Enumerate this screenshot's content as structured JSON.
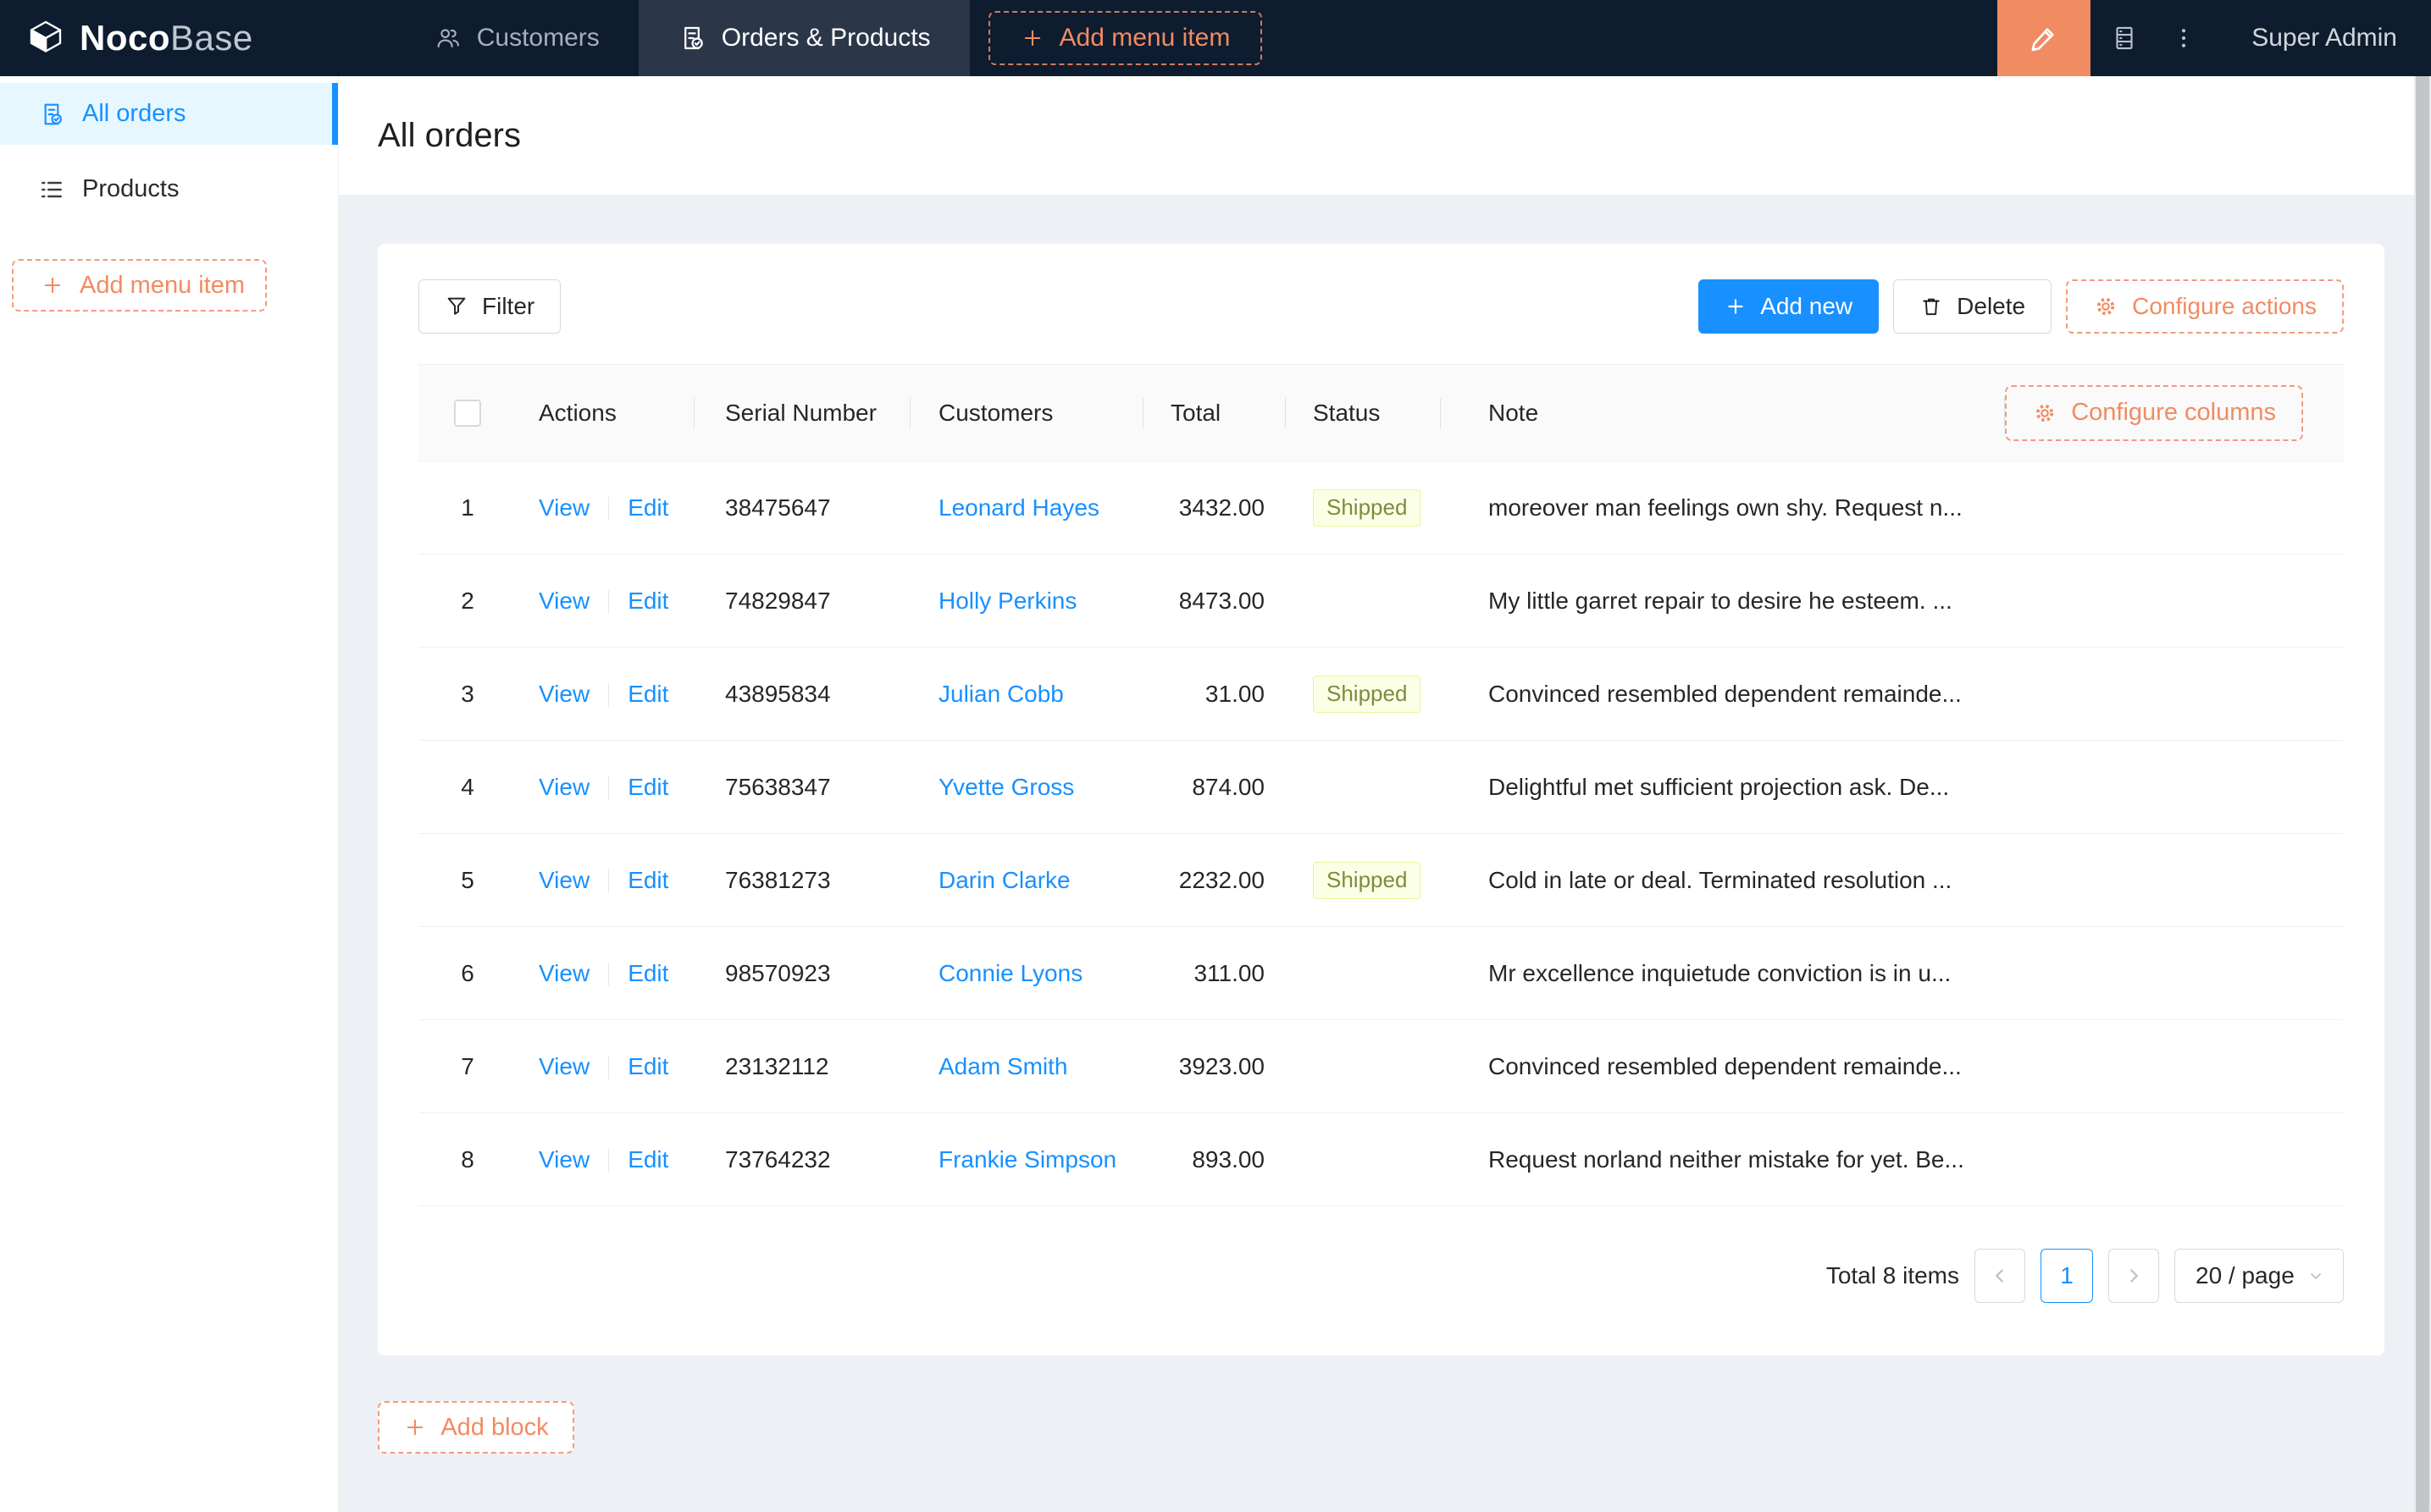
{
  "header": {
    "logo": {
      "bold": "Noco",
      "light": "Base"
    },
    "menu": [
      {
        "label": "Customers"
      },
      {
        "label": "Orders & Products"
      }
    ],
    "add_menu_item_label": "Add menu item",
    "user": "Super Admin"
  },
  "sidebar": {
    "items": [
      {
        "label": "All orders"
      },
      {
        "label": "Products"
      }
    ],
    "add_menu_item_label": "Add menu item"
  },
  "page": {
    "title": "All orders"
  },
  "toolbar": {
    "filter_label": "Filter",
    "add_new_label": "Add new",
    "delete_label": "Delete",
    "configure_actions_label": "Configure actions"
  },
  "table": {
    "configure_columns_label": "Configure columns",
    "columns": {
      "actions": "Actions",
      "serial": "Serial Number",
      "customers": "Customers",
      "total": "Total",
      "status": "Status",
      "note": "Note"
    },
    "actions": {
      "view": "View",
      "edit": "Edit"
    },
    "rows": [
      {
        "index": "1",
        "serial": "38475647",
        "customer": "Leonard Hayes",
        "total": "3432.00",
        "status": "Shipped",
        "note": "moreover man feelings own shy. Request n..."
      },
      {
        "index": "2",
        "serial": "74829847",
        "customer": "Holly Perkins",
        "total": "8473.00",
        "status": "",
        "note": "My little garret repair to desire he esteem. ..."
      },
      {
        "index": "3",
        "serial": "43895834",
        "customer": "Julian Cobb",
        "total": "31.00",
        "status": "Shipped",
        "note": "Convinced resembled dependent remainde..."
      },
      {
        "index": "4",
        "serial": "75638347",
        "customer": "Yvette Gross",
        "total": "874.00",
        "status": "",
        "note": "Delightful met sufficient projection ask. De..."
      },
      {
        "index": "5",
        "serial": "76381273",
        "customer": "Darin Clarke",
        "total": "2232.00",
        "status": "Shipped",
        "note": "Cold in late or deal. Terminated resolution ..."
      },
      {
        "index": "6",
        "serial": "98570923",
        "customer": "Connie Lyons",
        "total": "311.00",
        "status": "",
        "note": "Mr excellence inquietude conviction is in u..."
      },
      {
        "index": "7",
        "serial": "23132112",
        "customer": "Adam Smith",
        "total": "3923.00",
        "status": "",
        "note": "Convinced resembled dependent remainde..."
      },
      {
        "index": "8",
        "serial": "73764232",
        "customer": "Frankie Simpson",
        "total": "893.00",
        "status": "",
        "note": "Request norland neither mistake for yet. Be..."
      }
    ]
  },
  "pagination": {
    "total_text": "Total 8 items",
    "current_page": "1",
    "page_size": "20 / page"
  },
  "add_block_label": "Add block",
  "colors": {
    "accent_blue": "#1890FF",
    "brand_orange": "#F18B62",
    "header_bg": "#0E1C30",
    "selected_sidebar_bg": "#E6F7FF",
    "status_tag_bg": "#FCFFE6",
    "status_tag_border": "#EAF598",
    "status_tag_text": "#7C8C3D"
  }
}
